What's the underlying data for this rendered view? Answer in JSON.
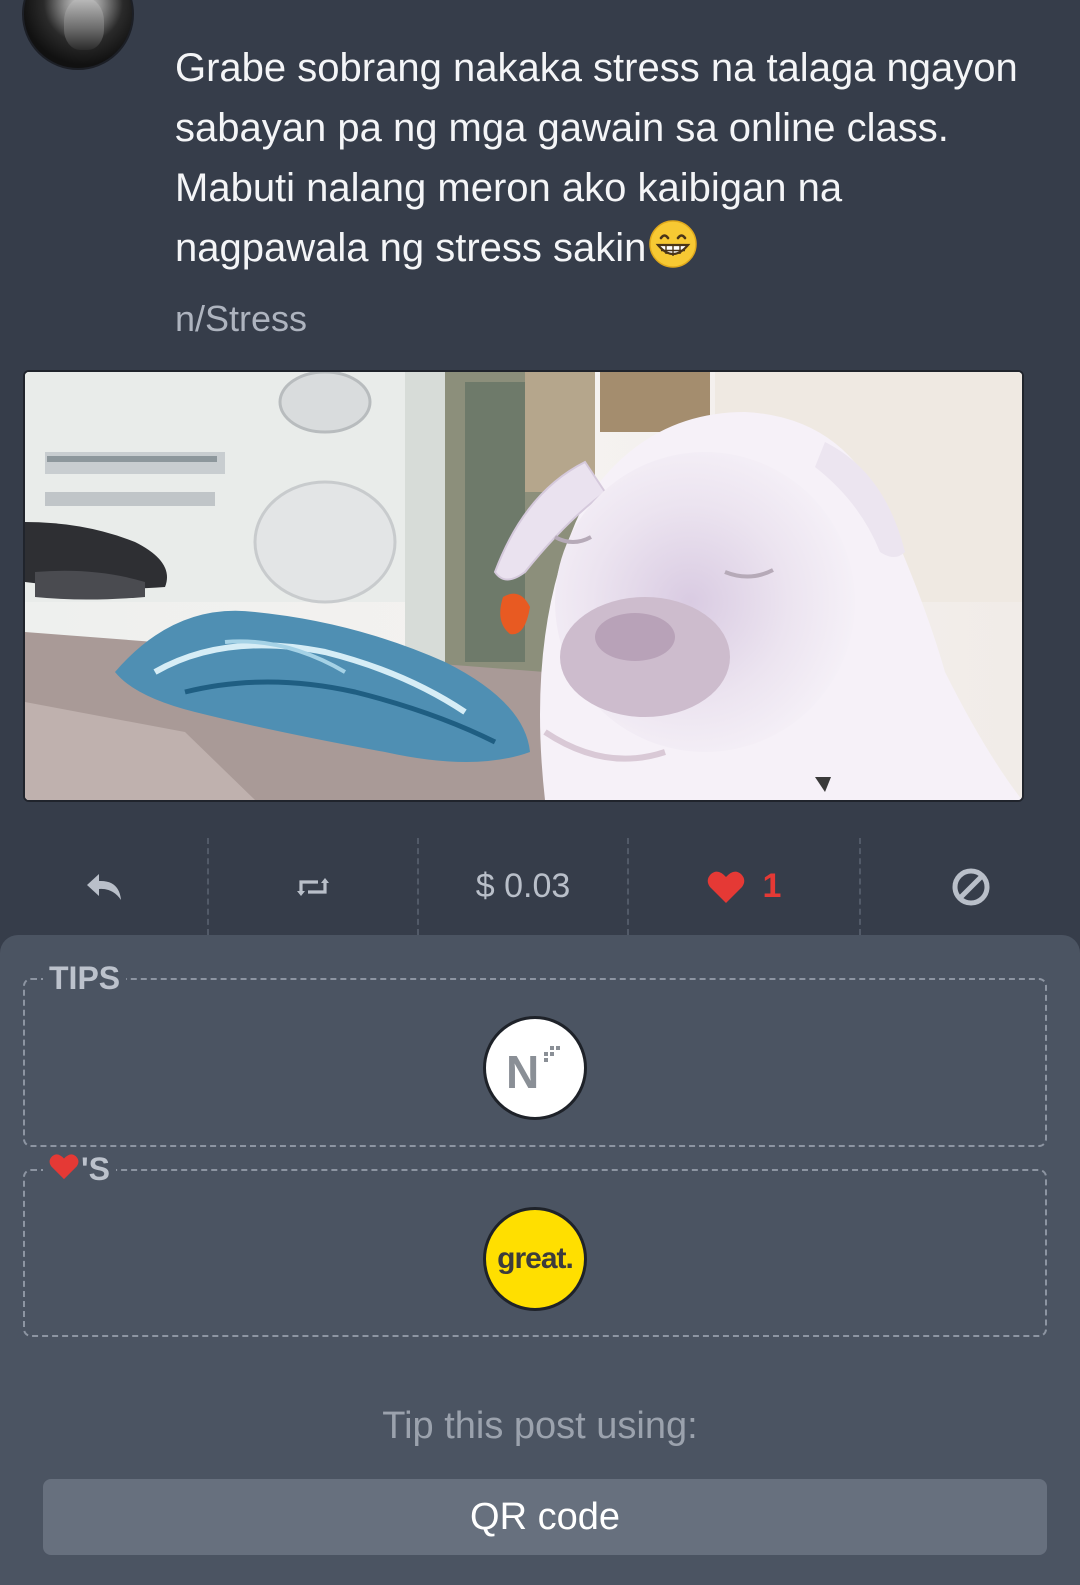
{
  "post": {
    "text": "Grabe sobrang nakaka stress na talaga ngayon sabayan pa ng mga gawain sa online class. Mabuti nalang meron ako kaibigan na nagpawala ng stress sakin",
    "emoji": "grinning-face-emoji",
    "community": "n/Stress"
  },
  "actions": {
    "reply_icon": "reply-icon",
    "repost_icon": "repost-icon",
    "value": "$ 0.03",
    "like_icon": "heart-icon",
    "like_count": "1",
    "block_icon": "block-icon",
    "like_color": "#e53935"
  },
  "tips": {
    "label": "TIPS",
    "tipper_badge": "N"
  },
  "likes_section": {
    "label_suffix": "'S",
    "liker_badge": "great."
  },
  "tip_prompt": "Tip this post using:",
  "qr_button": "QR code",
  "colors": {
    "background": "#363d4a",
    "panel": "#4b5462",
    "button": "#67707e",
    "great_badge": "#ffdf00"
  }
}
